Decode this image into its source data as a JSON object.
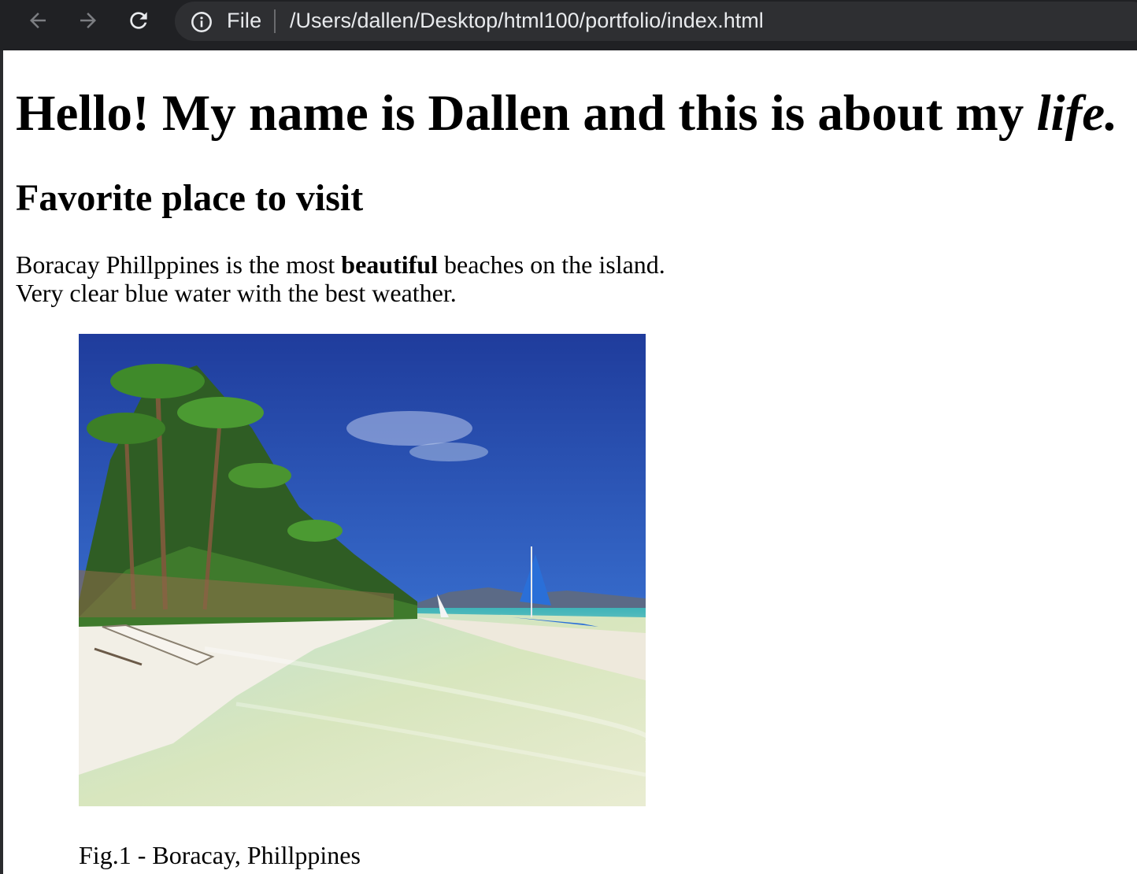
{
  "browser": {
    "scheme_label": "File",
    "url": "/Users/dallen/Desktop/html100/portfolio/index.html",
    "icons": [
      "back-arrow-icon",
      "forward-arrow-icon",
      "reload-icon",
      "info-icon"
    ],
    "toolbar_color": "#202124",
    "omnibox_color": "#2e2f32"
  },
  "page": {
    "heading_main": "Hello! My name is Dallen and this is about my ",
    "heading_emphasis": "life.",
    "subheading": "Favorite place to visit",
    "paragraph": {
      "part1": "Boracay Phillppines is the most ",
      "bold": "beautiful",
      "part2": " beaches on the island.",
      "line2": "Very clear blue water with the best weather."
    },
    "figure": {
      "image_subject": "tropical beach with palm trees, white sand, clear water and outrigger boats",
      "caption": "Fig.1 - Boracay, Phillppines"
    }
  }
}
